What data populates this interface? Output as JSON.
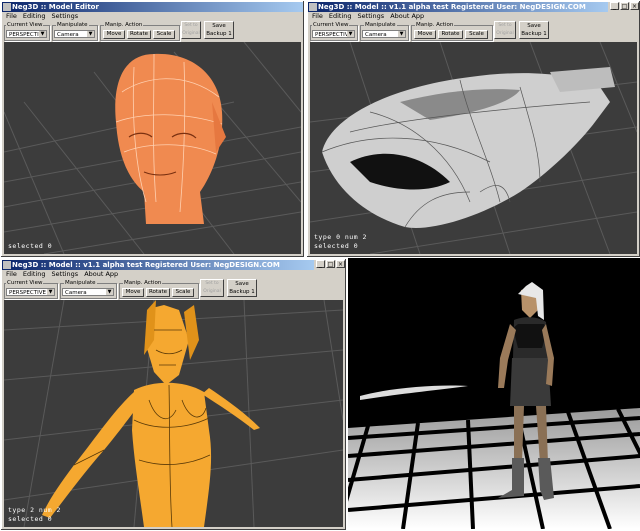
{
  "windows": [
    {
      "title": "Neg3D :: Model Editor",
      "menu": [
        "File",
        "Editing",
        "Settings"
      ],
      "current_view_label": "Current View",
      "current_view_value": "PERSPECTIVE",
      "manipulate_label": "Manipulate",
      "manipulate_value": "Camera",
      "manip_action_label": "Manip. Action",
      "actions": [
        "Move",
        "Rotate",
        "Scale"
      ],
      "extra_button": "Set to Original",
      "save_button": "Save Backup 1",
      "status_lines": [
        "selected 0"
      ]
    },
    {
      "title": "Neg3D :: Model :: v1.1 alpha test  Registered User: NegDESIGN.COM",
      "menu": [
        "File",
        "Editing",
        "Settings",
        "About App"
      ],
      "current_view_label": "Current View",
      "current_view_value": "PERSPECTIVE",
      "manipulate_label": "Manipulate",
      "manipulate_value": "Camera",
      "manip_action_label": "Manip. Action",
      "actions": [
        "Move",
        "Rotate",
        "Scale"
      ],
      "extra_button": "Set to Original",
      "save_button": "Save Backup 1",
      "status_lines": [
        "type 0 num 2",
        "selected 0"
      ]
    },
    {
      "title": "Neg3D :: Model :: v1.1 alpha test  Registered User: NegDESIGN.COM",
      "menu": [
        "File",
        "Editing",
        "Settings",
        "About App"
      ],
      "current_view_label": "Current View",
      "current_view_value": "PERSPECTIVE",
      "manipulate_label": "Manipulate",
      "manipulate_value": "Camera",
      "manip_action_label": "Manip. Action",
      "actions": [
        "Move",
        "Rotate",
        "Scale"
      ],
      "extra_button": "Set to Original",
      "save_button": "Save Backup 1",
      "status_lines": [
        "type 2 num 2",
        "selected 0"
      ]
    }
  ],
  "colors": {
    "titlebar_start": "#0a246a",
    "titlebar_end": "#a6caf0",
    "viewport_bg": "#3c3c3c",
    "head_color": "#f08a50",
    "car_color": "#cfcfcf",
    "figure_color": "#f5a830"
  }
}
